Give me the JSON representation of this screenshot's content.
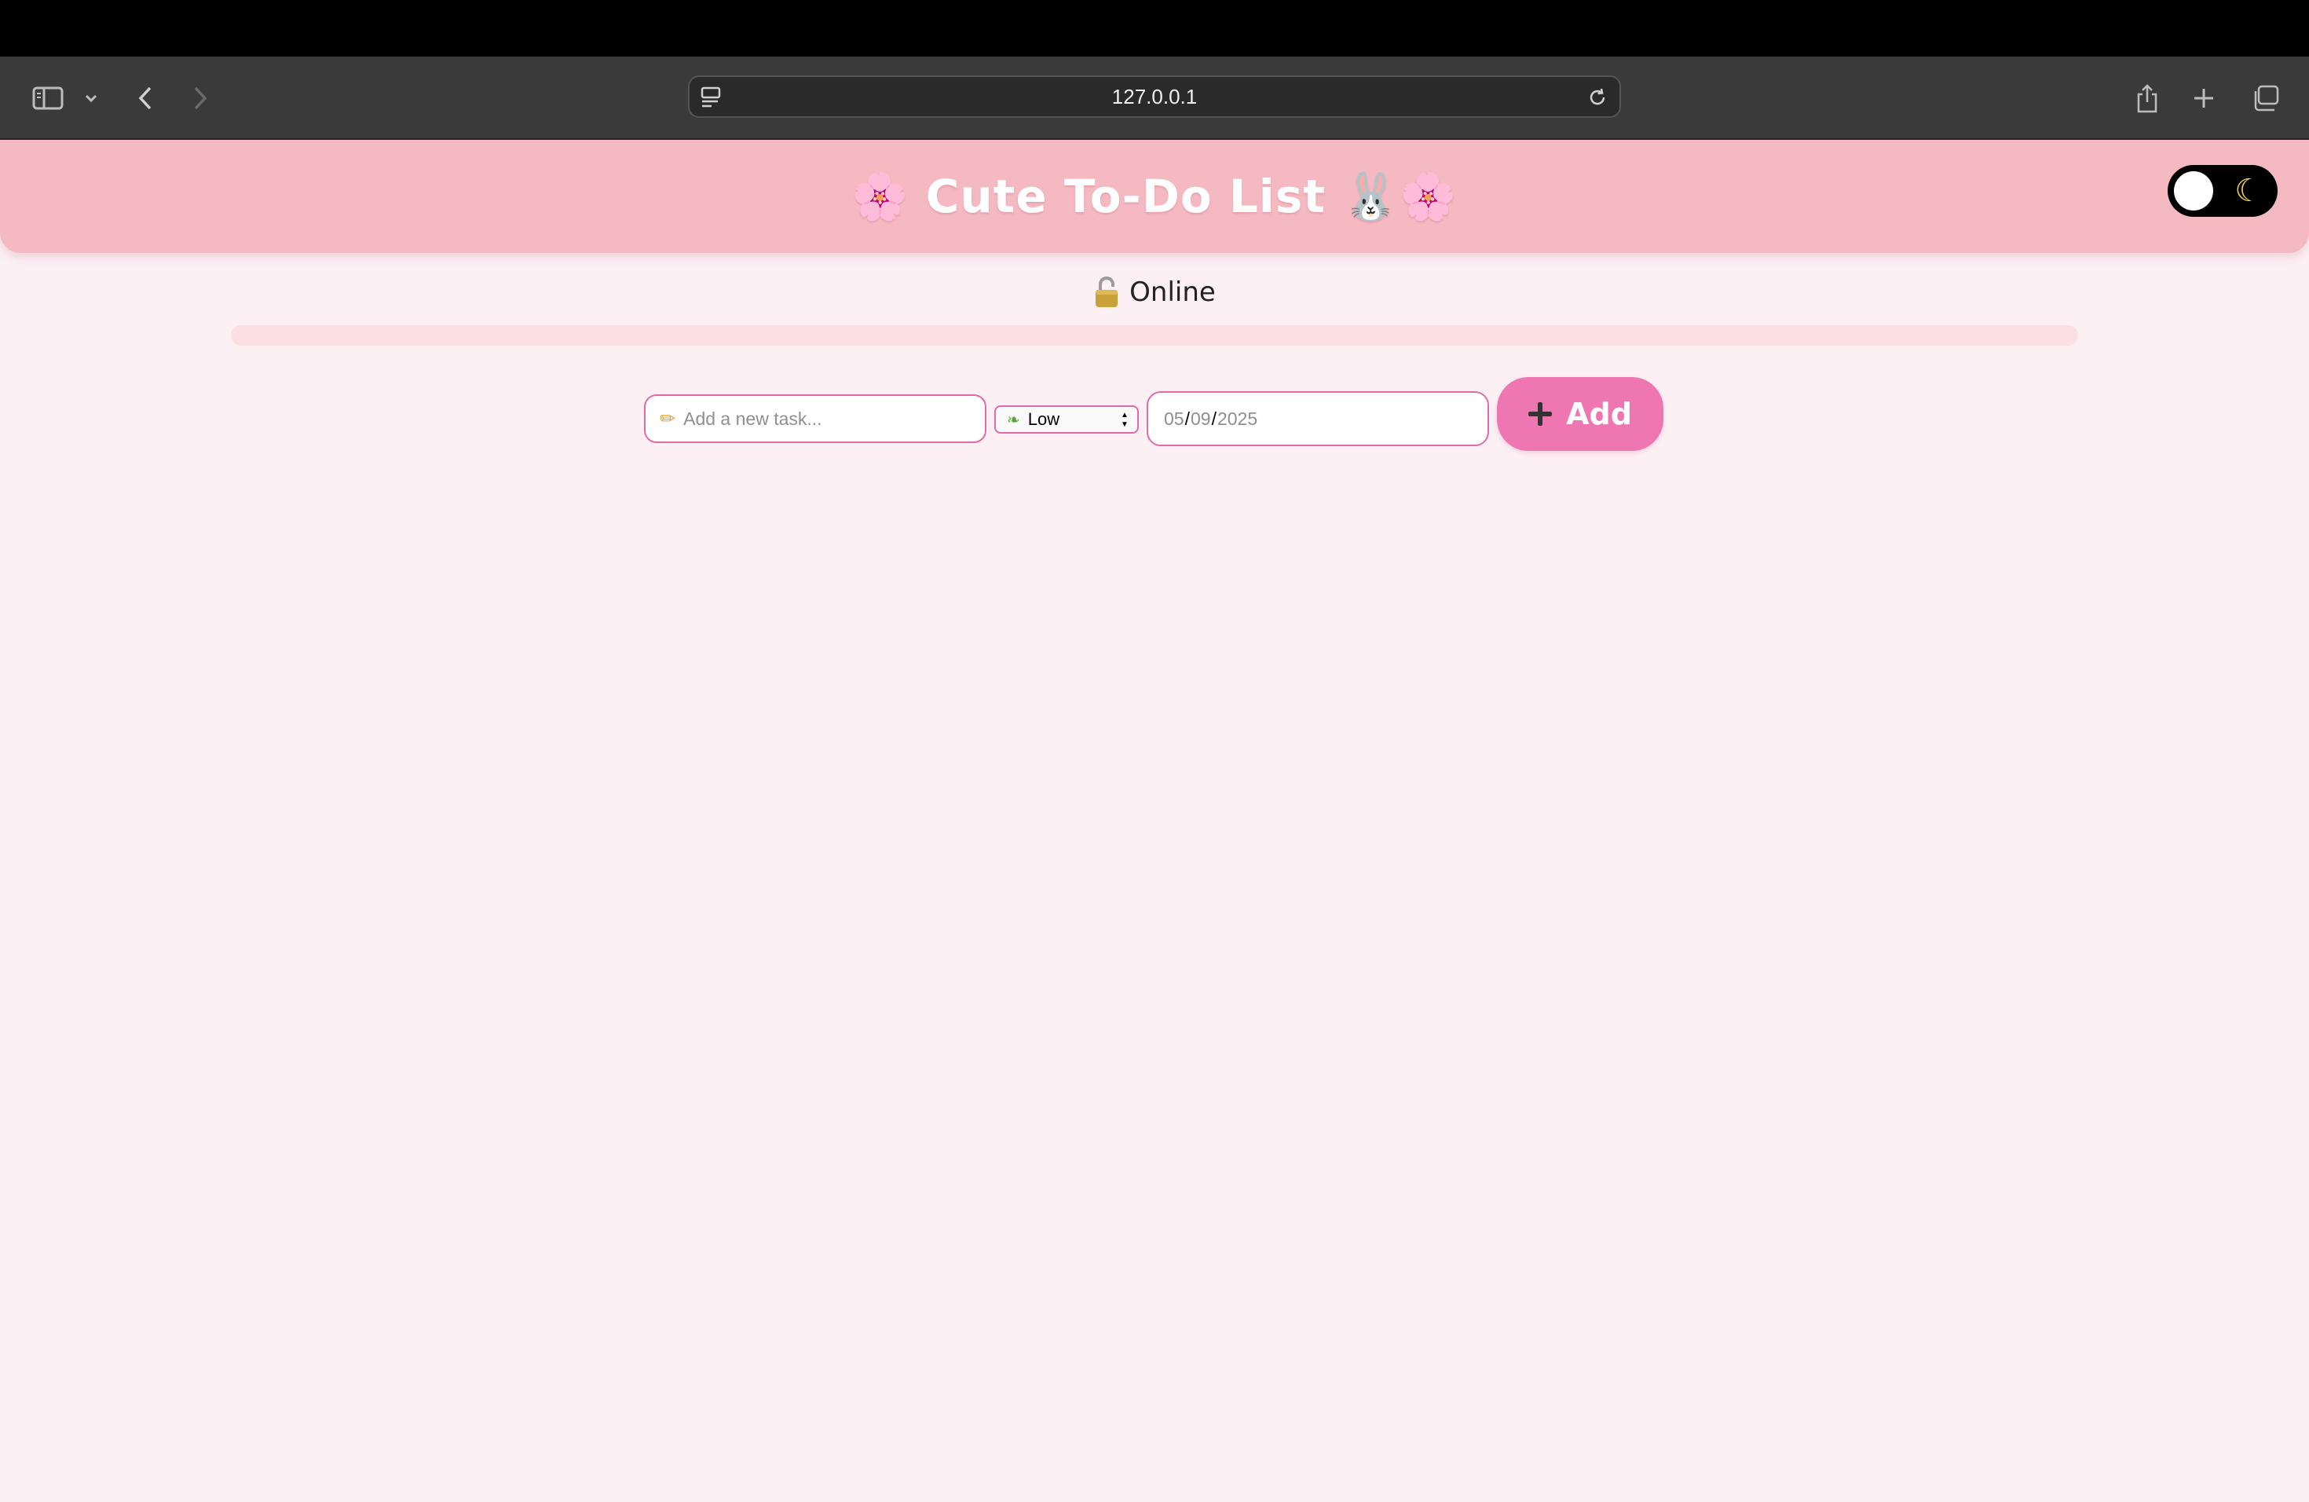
{
  "browser": {
    "url": "127.0.0.1",
    "icons": [
      "sidebar-icon",
      "chevron-down-icon",
      "back-icon",
      "forward-icon",
      "site-settings-icon",
      "reload-icon",
      "share-icon",
      "new-tab-icon",
      "tab-overview-icon"
    ]
  },
  "header": {
    "title": "🌸 Cute To-Do List 🐰🌸",
    "toggle_icon": "moon-icon"
  },
  "status": {
    "icon": "lock-icon",
    "text": "Online"
  },
  "progress": {
    "fraction": 0
  },
  "form": {
    "task_placeholder": "Add a new task...",
    "priority_value": "Low",
    "date": {
      "month": "05",
      "day": "09",
      "year": "2025"
    },
    "add_label": "Add"
  },
  "colors": {
    "header_bg": "#f5b9c2",
    "page_bg": "#fcf0f4",
    "accent": "#ef77b1",
    "input_border": "#e26aa6"
  }
}
